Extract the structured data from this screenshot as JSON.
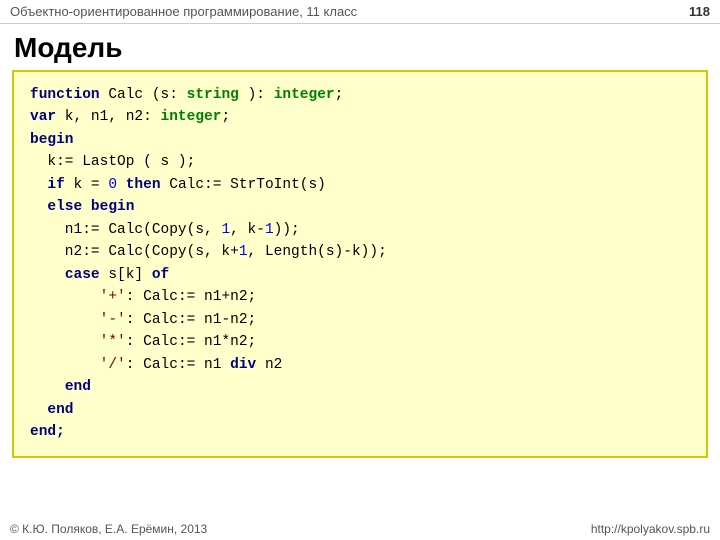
{
  "header": {
    "title": "Объектно-ориентированное программирование, 11 класс",
    "page_number": "118"
  },
  "main": {
    "title": "Модель"
  },
  "footer": {
    "left": "© К.Ю. Поляков, Е.А. Ерёмин, 2013",
    "right": "http://kpolyakov.spb.ru"
  }
}
